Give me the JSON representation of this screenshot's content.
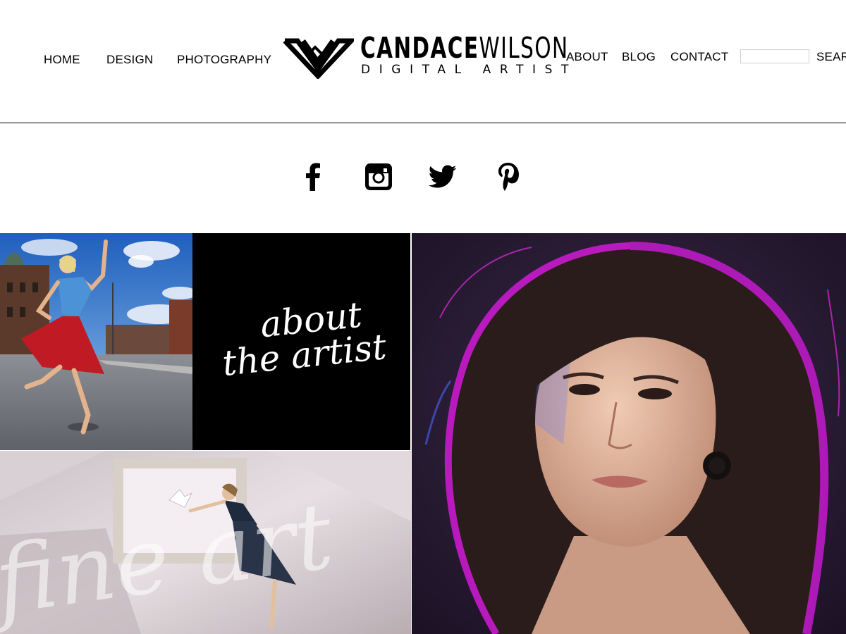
{
  "nav": {
    "left": [
      {
        "label": "HOME"
      },
      {
        "label": "DESIGN"
      },
      {
        "label": "PHOTOGRAPHY"
      }
    ],
    "right": [
      {
        "label": "ABOUT"
      },
      {
        "label": "BLOG"
      },
      {
        "label": "CONTACT"
      }
    ],
    "search": {
      "value": "",
      "label": "SEARC"
    }
  },
  "logo": {
    "name_bold": "CANDACE",
    "name_thin": "WILSON",
    "tagline": "DIGITAL ARTIST"
  },
  "social": {
    "icons": [
      "facebook-icon",
      "instagram-icon",
      "twitter-icon",
      "pinterest-icon"
    ]
  },
  "tiles": {
    "about": {
      "line1": "about",
      "line2": "the artist"
    },
    "fine_art": {
      "label": "fine art"
    }
  },
  "colors": {
    "text": "#000000",
    "background": "#ffffff",
    "tile_black": "#000000",
    "portrait_bg": "#2a1a36",
    "portrait_rim": "#d21ad8"
  }
}
